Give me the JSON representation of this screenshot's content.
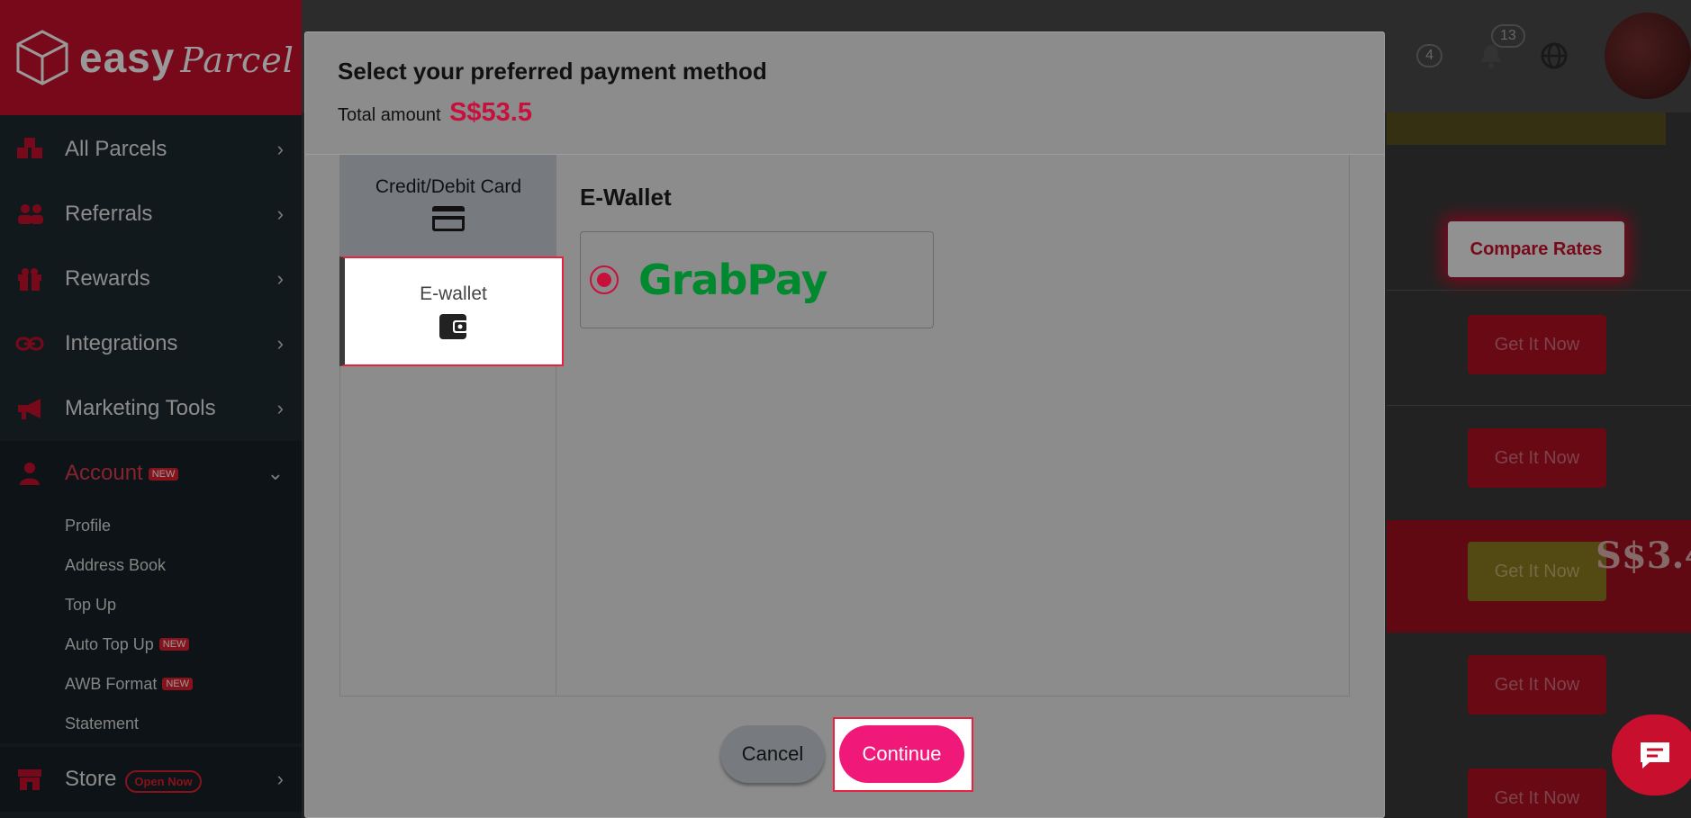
{
  "app": {
    "logo_text": "easy",
    "logo_script": "Parcel"
  },
  "sidebar": {
    "items": [
      {
        "label": "All Parcels",
        "icon": "parcels-icon"
      },
      {
        "label": "Referrals",
        "icon": "referrals-icon"
      },
      {
        "label": "Rewards",
        "icon": "gift-icon"
      },
      {
        "label": "Integrations",
        "icon": "link-icon"
      },
      {
        "label": "Marketing Tools",
        "icon": "megaphone-icon"
      }
    ],
    "account": {
      "label": "Account",
      "badge": "NEW"
    },
    "sub_items": [
      {
        "label": "Profile"
      },
      {
        "label": "Address Book"
      },
      {
        "label": "Top Up"
      },
      {
        "label": "Auto Top Up",
        "badge": "NEW"
      },
      {
        "label": "AWB Format",
        "badge": "NEW"
      },
      {
        "label": "Statement"
      }
    ],
    "store": {
      "label": "Store",
      "badge": "Open Now"
    }
  },
  "header": {
    "notification_count": "13",
    "other_count": "4"
  },
  "background": {
    "compare_rates": "Compare Rates",
    "get_it_now": "Get It Now",
    "promo_text": "S$3.4"
  },
  "modal": {
    "title": "Select your preferred payment method",
    "total_label": "Total amount",
    "total_amount": "S$53.5",
    "tabs": {
      "card": "Credit/Debit Card",
      "wallet": "E-wallet"
    },
    "section_title": "E-Wallet",
    "option": {
      "name": "GrabPay",
      "selected": true
    },
    "cancel_label": "Cancel",
    "continue_label": "Continue"
  },
  "colors": {
    "brand_red": "#c8102e",
    "accent_pink": "#f0197a",
    "total_red": "#c8103c",
    "grab_green": "#00892e"
  }
}
